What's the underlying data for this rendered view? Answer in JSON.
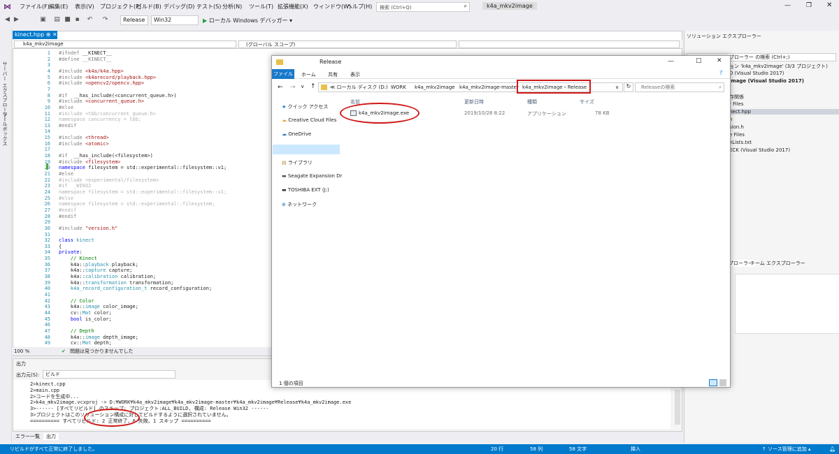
{
  "titlebar": {
    "menus": [
      "ファイル(F)",
      "編集(E)",
      "表示(V)",
      "プロジェクト(P)",
      "ビルド(B)",
      "デバッグ(D)",
      "テスト(S)",
      "分析(N)",
      "ツール(T)",
      "拡張機能(X)",
      "ウィンドウ(W)",
      "ヘルプ(H)"
    ],
    "search_placeholder": "検索 (Ctrl+Q)",
    "app_title": "k4a_mkv2image"
  },
  "toolbar": {
    "config": "Release",
    "platform": "Win32",
    "debugger": "ローカル Windows デバッガー"
  },
  "left_tabs": {
    "server": "サーバー エクスプローラー",
    "toolbox": "ツールボックス"
  },
  "editor": {
    "tab": "kinect.hpp",
    "nav_left": "k4a_mkv2image",
    "nav_mid": "(グローバル スコープ)",
    "zoom": "100 %",
    "issues": "問題は見つかりませんでした",
    "lines": [
      {
        "n": "1",
        "h": "<span class='pp'>#ifndef</span> __KINECT__"
      },
      {
        "n": "2",
        "h": "<span class='pp'>#define</span> <span class='pp'>__KINECT__</span>"
      },
      {
        "n": "3",
        "h": ""
      },
      {
        "n": "4",
        "h": "<span class='pp'>#include</span> <span class='str'>&lt;k4a/k4a.hpp&gt;</span>"
      },
      {
        "n": "5",
        "h": "<span class='pp'>#include</span> <span class='str'>&lt;k4arecord/playback.hpp&gt;</span>"
      },
      {
        "n": "6",
        "h": "<span class='pp'>#include</span> <span class='str'>&lt;opencv2/opencv.hpp&gt;</span>"
      },
      {
        "n": "7",
        "h": ""
      },
      {
        "n": "8",
        "h": "<span class='pp'>#if</span>  __has_include(&lt;concurrent_queue.h&gt;)"
      },
      {
        "n": "9",
        "h": "<span class='pp'>#include</span> <span class='str'>&lt;concurrent_queue.h&gt;</span>"
      },
      {
        "n": "10",
        "h": "<span class='pp'>#else</span>"
      },
      {
        "n": "11",
        "h": "<span class='gr'>#include &lt;tbb/concurrent_queue.h&gt;</span>"
      },
      {
        "n": "12",
        "h": "<span class='gr'>namespace concurrency = tbb;</span>"
      },
      {
        "n": "13",
        "h": "<span class='pp'>#endif</span>"
      },
      {
        "n": "14",
        "h": ""
      },
      {
        "n": "15",
        "h": "<span class='pp'>#include</span> <span class='str'>&lt;thread&gt;</span>"
      },
      {
        "n": "16",
        "h": "<span class='pp'>#include</span> <span class='str'>&lt;atomic&gt;</span>"
      },
      {
        "n": "17",
        "h": ""
      },
      {
        "n": "18",
        "h": "<span class='pp'>#if</span>  __has_include(&lt;filesystem&gt;)"
      },
      {
        "n": "19",
        "h": "<span class='pp'>#include</span> <span class='str'>&lt;filesystem&gt;</span>"
      },
      {
        "n": "20",
        "h": "<span class='kw'>namespace</span> filesystem = std::experimental::filesystem::v1;"
      },
      {
        "n": "21",
        "h": "<span class='pp'>#else</span>"
      },
      {
        "n": "22",
        "h": "<span class='gr'>#include &lt;experimental/filesystem&gt;</span>"
      },
      {
        "n": "23",
        "h": "<span class='gr'>#if  _WIN32</span>"
      },
      {
        "n": "24",
        "h": "<span class='gr'>namespace filesystem = std::experimental::filesystem::v1;</span>"
      },
      {
        "n": "25",
        "h": "<span class='gr'>#else</span>"
      },
      {
        "n": "26",
        "h": "<span class='gr'>namespace filesystem = std::experimental::filesystem;</span>"
      },
      {
        "n": "27",
        "h": "<span class='gr'>#endif</span>"
      },
      {
        "n": "28",
        "h": "<span class='pp'>#endif</span>"
      },
      {
        "n": "29",
        "h": ""
      },
      {
        "n": "30",
        "h": "<span class='pp'>#include</span> <span class='str'>\"version.h\"</span>"
      },
      {
        "n": "31",
        "h": ""
      },
      {
        "n": "32",
        "h": "<span class='kw'>class</span> <span class='ty'>kinect</span>"
      },
      {
        "n": "33",
        "h": "{"
      },
      {
        "n": "34",
        "h": "<span class='kw'>private</span>:"
      },
      {
        "n": "35",
        "h": "    <span class='cm'>// Kinect</span>"
      },
      {
        "n": "36",
        "h": "    k4a::<span class='ty'>playback</span> playback;"
      },
      {
        "n": "37",
        "h": "    k4a::<span class='ty'>capture</span> capture;"
      },
      {
        "n": "38",
        "h": "    k4a::<span class='ty'>calibration</span> calibration;"
      },
      {
        "n": "39",
        "h": "    k4a::<span class='ty'>transformation</span> transformation;"
      },
      {
        "n": "40",
        "h": "    <span class='ty'>k4a_record_configuration_t</span> record_configuration;"
      },
      {
        "n": "41",
        "h": ""
      },
      {
        "n": "42",
        "h": "    <span class='cm'>// Color</span>"
      },
      {
        "n": "43",
        "h": "    k4a::<span class='ty'>image</span> color_image;"
      },
      {
        "n": "44",
        "h": "    cv::<span class='ty'>Mat</span> color;"
      },
      {
        "n": "45",
        "h": "    <span class='kw'>bool</span> is_color;"
      },
      {
        "n": "46",
        "h": ""
      },
      {
        "n": "47",
        "h": "    <span class='cm'>// Depth</span>"
      },
      {
        "n": "48",
        "h": "    k4a::<span class='ty'>image</span> depth_image;"
      },
      {
        "n": "49",
        "h": "    cv::<span class='ty'>Mat</span> depth;"
      }
    ]
  },
  "output": {
    "title": "出力",
    "source_label": "出力元(S):",
    "source_value": "ビルド",
    "lines": [
      "2>kinect.cpp",
      "2>main.cpp",
      "2>コードを生成中...",
      "2>k4a_mkv2image.vcxproj -> D:¥WORK¥k4a_mkv2image¥k4a_mkv2image-master¥k4a_mkv2image¥Release¥k4a_mkv2image.exe",
      "3>------ [すべてリビルド] のスキップ: プロジェクト:ALL_BUILD, 構成: Release Win32 ------",
      "3>プロジェクトはこのソリューション構成に対してビルドするように選択されていません。",
      "========== すべてリビルド: 2 正常終了、0 失敗、1 スキップ =========="
    ]
  },
  "bottom_tabs": [
    "エラー一覧",
    "出力"
  ],
  "status": {
    "message": "リビルドがすべて正常に終了しました。",
    "line": "20 行",
    "col": "58 列",
    "char": "58 文字",
    "mode": "挿入",
    "scm": "↑ ソース管理に追加 ▴"
  },
  "solution": {
    "title": "ソリューション エクスプローラー",
    "search": "プローラー の検索 (Ctrl+;)",
    "items": [
      "ョン 'k4a_mkv2image' (3/3 プロジェクト)",
      "D (Visual Studio 2017)",
      "image (Visual Studio 2017)",
      "存関係",
      "r Files",
      "nect.hpp",
      "h",
      "sion.h",
      "e Files",
      "eLists.txt",
      "ECK (Visual Studio 2017)"
    ],
    "tabs": [
      "プローラー",
      "チーム エクスプローラー"
    ]
  },
  "explorer": {
    "title": "Release",
    "ribbon": [
      "ファイル",
      "ホーム",
      "共有",
      "表示"
    ],
    "path": [
      "≪ ローカル ディスク (D:)",
      "WORK",
      "k4a_mkv2image",
      "k4a_mkv2image-master"
    ],
    "path_hl": "k4a_mkv2image  ›  Release",
    "search_placeholder": "Releaseの検索",
    "nav": [
      "クイック アクセス",
      "Creative Cloud Files",
      "OneDrive",
      "PC",
      "ライブラリ",
      "Seagate Expansion Dr",
      "TOSHIBA EXT (J:)",
      "ネットワーク"
    ],
    "headers": [
      "名前",
      "更新日時",
      "種類",
      "サイズ"
    ],
    "file": {
      "name": "k4a_mkv2image.exe",
      "date": "2019/10/28 8:22",
      "type": "アプリケーション",
      "size": "78 KB"
    },
    "count": "1 個の項目"
  },
  "colors": {
    "accent": "#007acc",
    "annotation": "#d01818"
  }
}
